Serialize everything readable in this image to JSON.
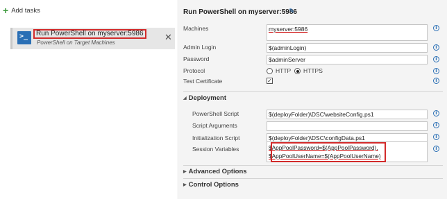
{
  "left_panel": {
    "add_tasks_label": "Add tasks",
    "task": {
      "icon_text": ">_",
      "title": "Run PowerShell on myserver:5986",
      "subtitle": "PowerShell on Target Machines",
      "close": "✕"
    }
  },
  "task_editor": {
    "title": "Run PowerShell on myserver:5986",
    "fields": {
      "machines": {
        "label": "Machines",
        "value": "myserver:5986"
      },
      "admin_login": {
        "label": "Admin Login",
        "value": "$(adminLogin)"
      },
      "password": {
        "label": "Password",
        "value": "$adminServer"
      },
      "protocol": {
        "label": "Protocol",
        "options": [
          "HTTP",
          "HTTPS"
        ],
        "selected": "HTTPS"
      },
      "test_certificate": {
        "label": "Test Certificate",
        "checked": true
      }
    },
    "deployment": {
      "title": "Deployment",
      "powershell_script": {
        "label": "PowerShell Script",
        "value": "$(deployFolder)\\DSC\\websiteConfig.ps1"
      },
      "script_arguments": {
        "label": "Script Arguments",
        "value": ""
      },
      "initialization_script": {
        "label": "Initialization Script",
        "value": "$(deployFolder)\\DSC\\configData.ps1"
      },
      "session_variables": {
        "label": "Session Variables",
        "line1": "$AppPoolPassword=$(AppPoolPassword),",
        "line2": "$AppPoolUserName=$(AppPoolUserName)"
      }
    },
    "advanced_options": {
      "title": "Advanced Options"
    },
    "control_options": {
      "title": "Control Options"
    }
  },
  "colors": {
    "accent": "#2a6fb5",
    "highlight_border": "#d22a2a",
    "add_icon": "#3e9a3e",
    "panel_background": "#f4f4f4",
    "selected_task_background": "#e6e6e6"
  }
}
